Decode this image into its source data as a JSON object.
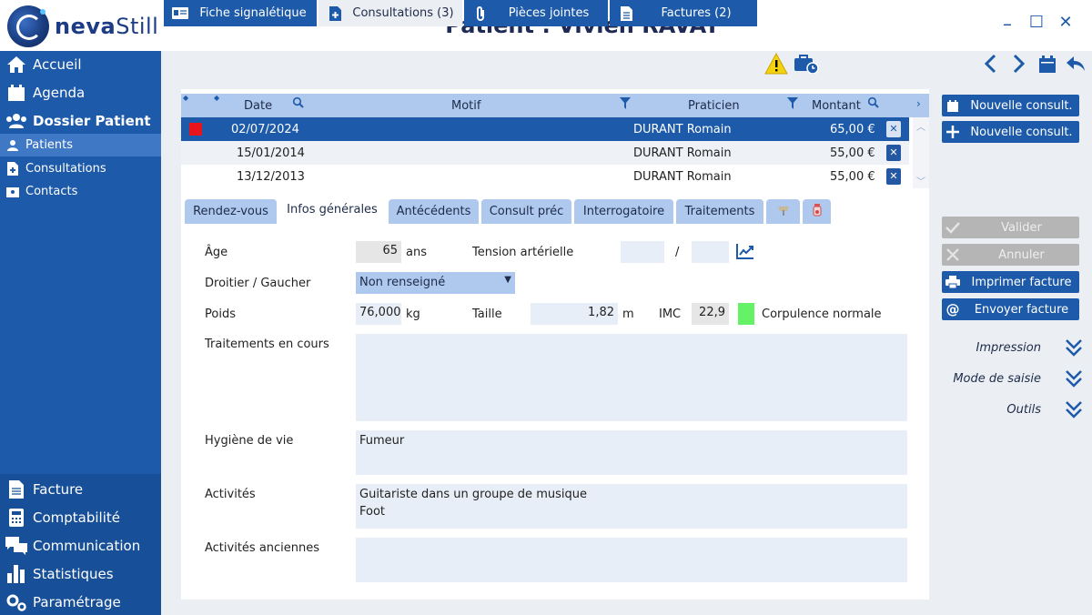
{
  "app": {
    "logo_brand_1": "neva",
    "logo_brand_2": "Still",
    "window_title": "Patient : Vivien RAVAT",
    "minimize": "–",
    "maximize": "☐",
    "close": "✕"
  },
  "sidebar": {
    "items_top": [
      {
        "label": "Accueil",
        "icon": "home-icon"
      },
      {
        "label": "Agenda",
        "icon": "calendar-icon"
      },
      {
        "label": "Dossier Patient",
        "icon": "users-icon"
      }
    ],
    "sub_items": [
      {
        "label": "Patients",
        "icon": "users-icon",
        "active": true
      },
      {
        "label": "Consultations",
        "icon": "doc-plus-icon"
      },
      {
        "label": "Contacts",
        "icon": "contact-card-icon"
      }
    ],
    "items_bottom": [
      {
        "label": "Facture",
        "icon": "invoice-icon"
      },
      {
        "label": "Comptabilité",
        "icon": "calculator-icon"
      },
      {
        "label": "Communication",
        "icon": "chat-icon"
      },
      {
        "label": "Statistiques",
        "icon": "bar-chart-icon"
      },
      {
        "label": "Paramétrage",
        "icon": "gears-icon"
      }
    ]
  },
  "main_tabs": [
    {
      "label": "Fiche signalétique",
      "icon": "id-card-icon"
    },
    {
      "label": "Consultations (3)",
      "icon": "doc-plus-icon",
      "active": true
    },
    {
      "label": "Pièces jointes",
      "icon": "paperclip-icon"
    },
    {
      "label": "Factures (2)",
      "icon": "invoice-icon"
    }
  ],
  "table": {
    "columns": [
      "Date",
      "Motif",
      "Praticien",
      "Montant"
    ],
    "rows": [
      {
        "date": "02/07/2024",
        "motif": "",
        "praticien": "DURANT Romain",
        "montant": "65,00 €",
        "selected": true,
        "flag_color": "#e8141b"
      },
      {
        "date": "15/01/2014",
        "motif": "",
        "praticien": "DURANT Romain",
        "montant": "55,00 €"
      },
      {
        "date": "13/12/2013",
        "motif": "",
        "praticien": "DURANT Romain",
        "montant": "55,00 €"
      }
    ]
  },
  "sub_tabs": [
    {
      "label": "Rendez-vous"
    },
    {
      "label": "Infos générales",
      "active": true
    },
    {
      "label": "Antécédents"
    },
    {
      "label": "Consult préc"
    },
    {
      "label": "Interrogatoire"
    },
    {
      "label": "Traitements"
    }
  ],
  "form": {
    "age_label": "Âge",
    "age_value": "65",
    "age_unit": "ans",
    "tension_label": "Tension artérielle",
    "tension_sep": "/",
    "lateralite_label": "Droitier / Gaucher",
    "lateralite_value": "Non renseigné",
    "poids_label": "Poids",
    "poids_value": "76,000",
    "poids_unit": "kg",
    "taille_label": "Taille",
    "taille_value": "1,82",
    "taille_unit": "m",
    "imc_label": "IMC",
    "imc_value": "22,9",
    "imc_color": "#66f266",
    "corpulence": "Corpulence normale",
    "traitements_label": "Traitements en cours",
    "traitements_value": "",
    "hygiene_label": "Hygiène de vie",
    "hygiene_value": "Fumeur",
    "activites_label": "Activités",
    "activites_line1": "Guitariste dans un groupe de musique",
    "activites_line2": "Foot",
    "activites_anciennes_label": "Activités anciennes",
    "activites_anciennes_value": ""
  },
  "right_panel": {
    "btn_new_consult_1": "Nouvelle consult.",
    "btn_new_consult_2": "Nouvelle consult.",
    "btn_valider": "Valider",
    "btn_annuler": "Annuler",
    "btn_imprimer": "Imprimer facture",
    "btn_envoyer": "Envoyer facture",
    "sections": [
      "Impression",
      "Mode de saisie",
      "Outils"
    ]
  }
}
